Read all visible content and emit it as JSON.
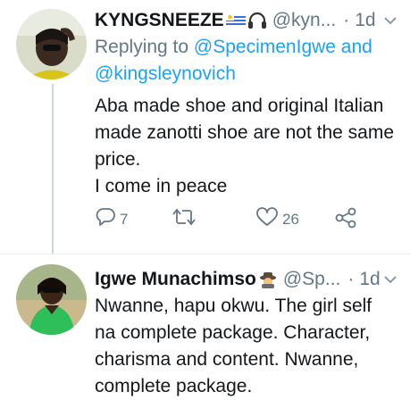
{
  "tweet1": {
    "name": "KYNGSNEEZE",
    "handle": "@kyn...",
    "dot": "·",
    "time": "1d",
    "reply_prefix": "Replying to ",
    "mention1": "@SpecimenIgwe",
    "reply_and": " and",
    "mention2": "@kingsleynovich",
    "text": "Aba made shoe and original Italian made zanotti shoe are not the same price.",
    "text2": "I come in peace",
    "reply_count": "7",
    "retweet_count": "",
    "like_count": "26"
  },
  "tweet2": {
    "name": "Igwe Munachimso",
    "handle": "@Sp...",
    "dot": "·",
    "time": "1d",
    "text": "Nwanne, hapu okwu. The girl self na complete package. Character, charisma and content. Nwanne, complete package."
  },
  "colors": {
    "link": "#1da1f2",
    "secondary": "#657786",
    "line": "#ccd6dd"
  }
}
